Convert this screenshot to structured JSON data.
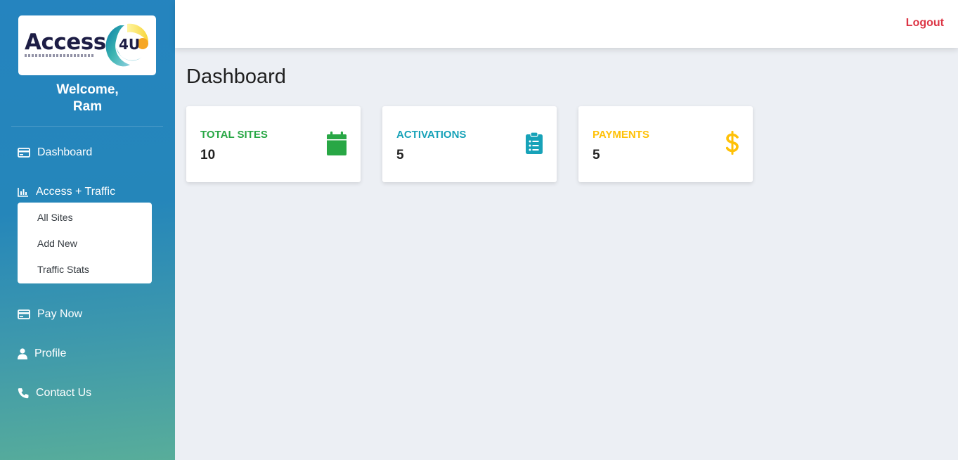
{
  "brand": {
    "name": "Access",
    "mark": "4U"
  },
  "welcome": {
    "line1": "Welcome,",
    "line2": "Ram"
  },
  "nav": {
    "dashboard": "Dashboard",
    "access_traffic": "Access + Traffic",
    "submenu": [
      "All Sites",
      "Add New",
      "Traffic Stats"
    ],
    "pay_now": "Pay Now",
    "profile": "Profile",
    "contact_us": "Contact Us"
  },
  "header": {
    "logout": "Logout"
  },
  "page": {
    "title": "Dashboard"
  },
  "cards": [
    {
      "label": "TOTAL SITES",
      "value": "10",
      "color": "#28a745",
      "icon": "calendar-icon"
    },
    {
      "label": "ACTIVATIONS",
      "value": "5",
      "color": "#17a2b8",
      "icon": "clipboard-list-icon"
    },
    {
      "label": "PAYMENTS",
      "value": "5",
      "color": "#ffc107",
      "icon": "dollar-icon"
    }
  ],
  "colors": {
    "sidebar_top": "#2584bf",
    "sidebar_bottom": "#58ad9a",
    "logout": "#dc3545",
    "background": "#eceff4"
  }
}
